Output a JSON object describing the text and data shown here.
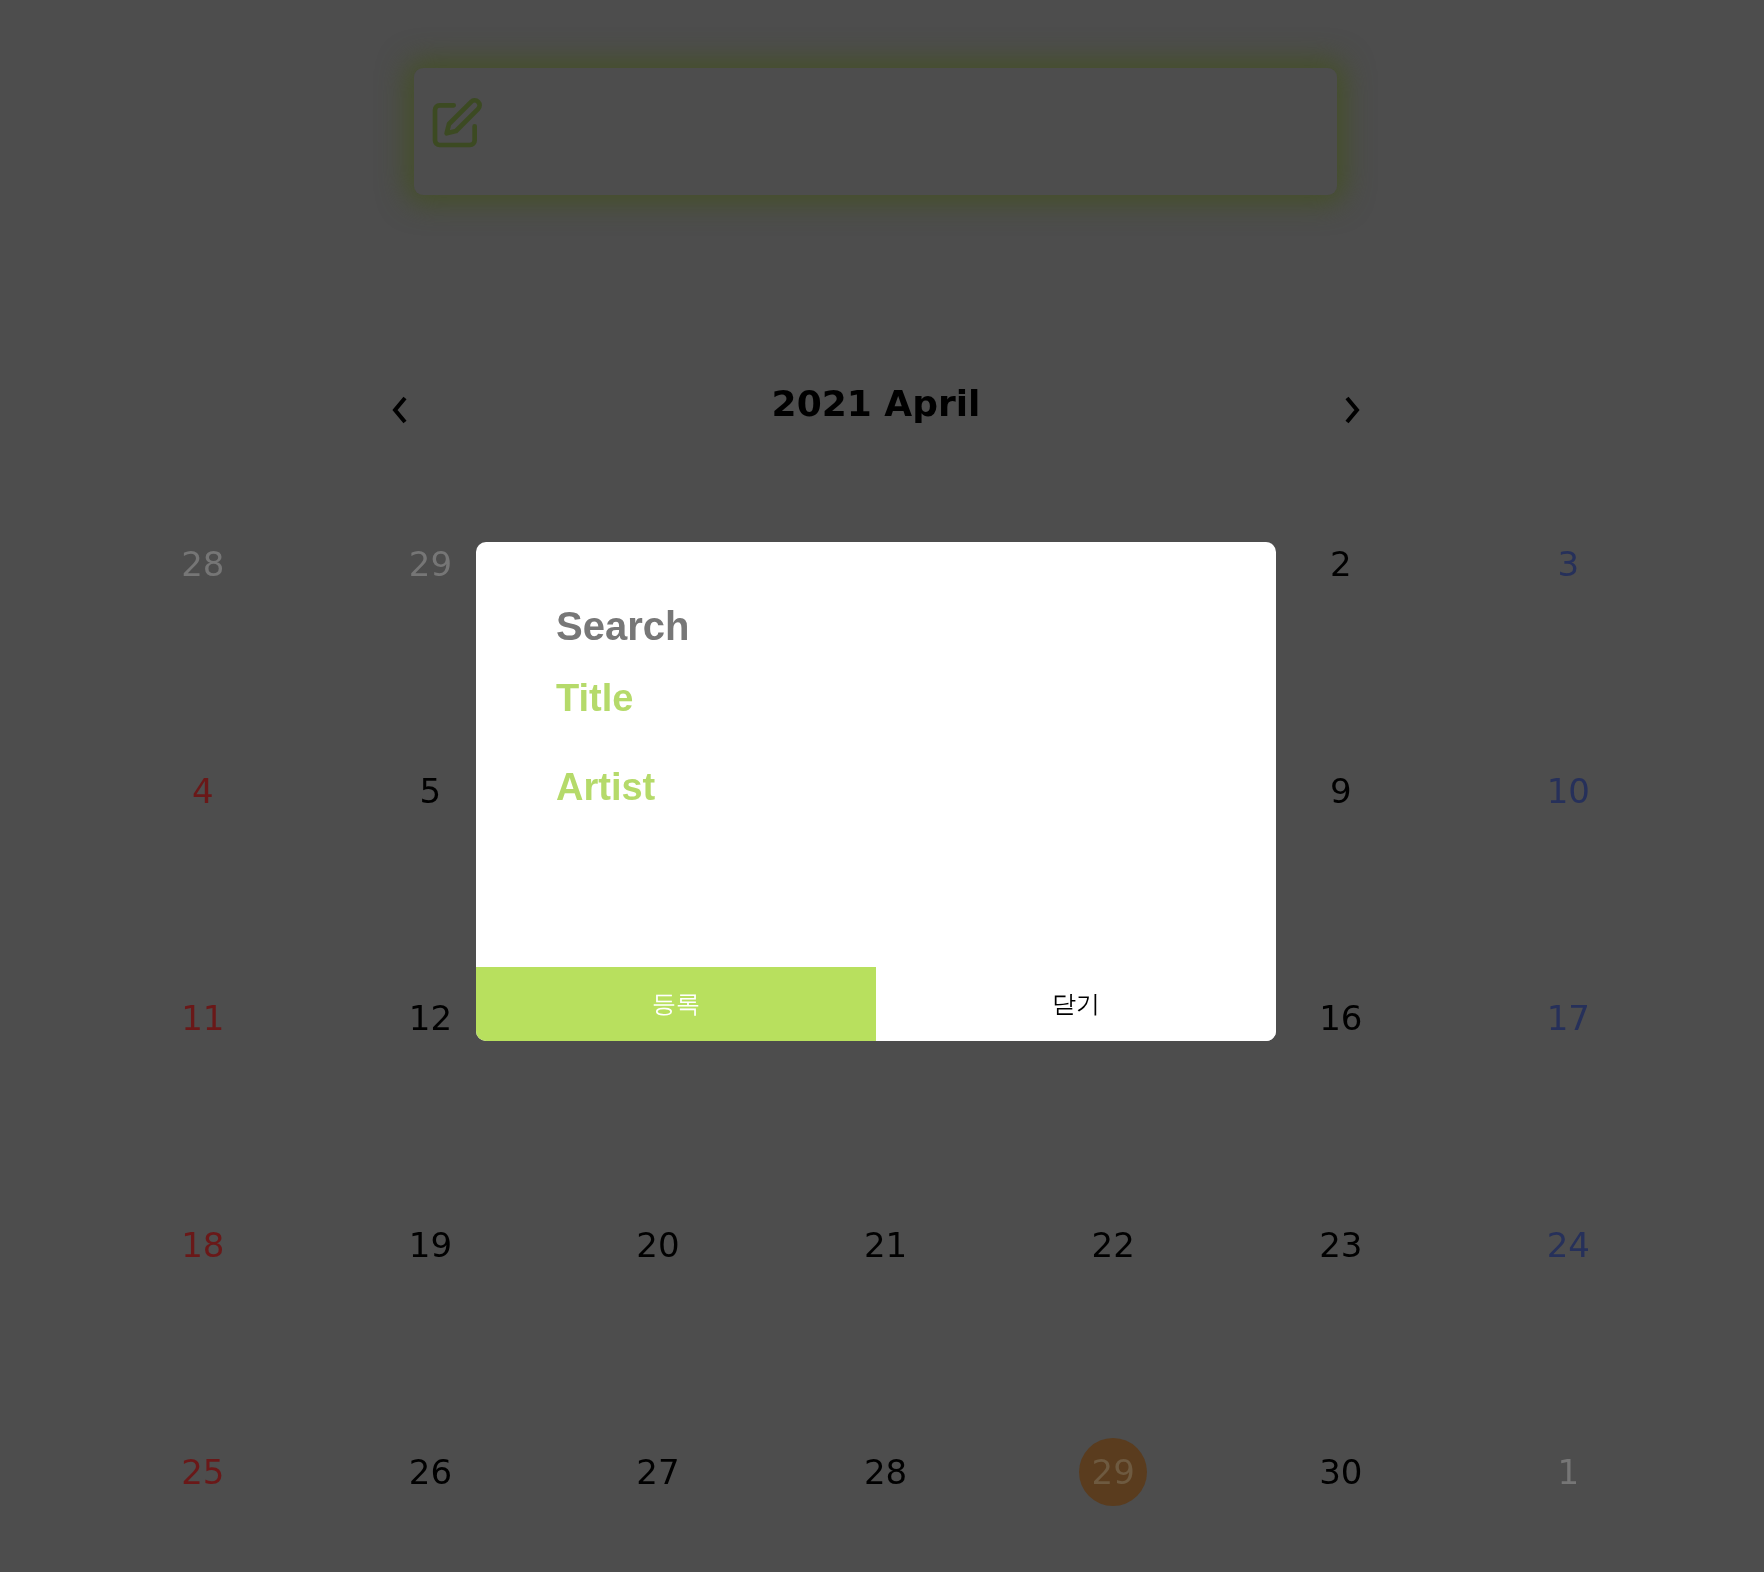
{
  "calendar": {
    "title": "2021 April",
    "weeks": [
      {
        "days": [
          {
            "label": "28",
            "kind": "other"
          },
          {
            "label": "29",
            "kind": "other"
          },
          {
            "label": "2",
            "kind": "weekday"
          },
          {
            "label": "3",
            "kind": "saturday"
          }
        ]
      },
      {
        "days": [
          {
            "label": "4",
            "kind": "sunday"
          },
          {
            "label": "5",
            "kind": "weekday"
          },
          {
            "label": "9",
            "kind": "weekday"
          },
          {
            "label": "10",
            "kind": "saturday"
          }
        ]
      },
      {
        "days": [
          {
            "label": "11",
            "kind": "sunday"
          },
          {
            "label": "12",
            "kind": "weekday"
          },
          {
            "label": "16",
            "kind": "weekday"
          },
          {
            "label": "17",
            "kind": "saturday"
          }
        ]
      },
      {
        "days": [
          {
            "label": "18",
            "kind": "sunday"
          },
          {
            "label": "19",
            "kind": "weekday"
          },
          {
            "label": "20",
            "kind": "weekday"
          },
          {
            "label": "21",
            "kind": "weekday"
          },
          {
            "label": "22",
            "kind": "weekday"
          },
          {
            "label": "23",
            "kind": "weekday"
          },
          {
            "label": "24",
            "kind": "saturday"
          }
        ]
      },
      {
        "days": [
          {
            "label": "25",
            "kind": "sunday"
          },
          {
            "label": "26",
            "kind": "weekday"
          },
          {
            "label": "27",
            "kind": "weekday"
          },
          {
            "label": "28",
            "kind": "weekday"
          },
          {
            "label": "29",
            "kind": "today"
          },
          {
            "label": "30",
            "kind": "weekday"
          },
          {
            "label": "1",
            "kind": "other"
          }
        ]
      }
    ]
  },
  "dialog": {
    "title": "Search",
    "fields": [
      {
        "label": "Title"
      },
      {
        "label": "Artist"
      }
    ],
    "buttons": [
      {
        "label": "등록",
        "kind": "primary"
      },
      {
        "label": "닫기",
        "kind": "plain"
      }
    ]
  }
}
